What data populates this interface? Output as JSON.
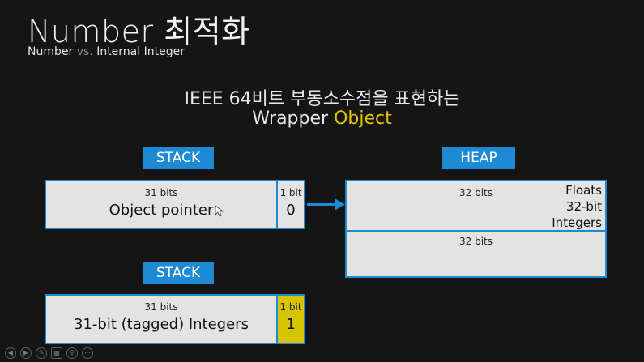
{
  "title": "Number 최적화",
  "subtitle": {
    "part1": "Number",
    "vs": "vs.",
    "part2": "Internal Integer"
  },
  "heading": {
    "line1": "IEEE 64비트 부동소수점을 표현하는",
    "line2_plain": "Wrapper",
    "line2_accent": "Object"
  },
  "stack_top": {
    "label": "STACK",
    "left_small": "31 bits",
    "left_big": "Object pointer",
    "right_small": "1 bit",
    "right_big": "0"
  },
  "heap": {
    "label": "HEAP",
    "top_small": "32 bits",
    "top_right_lines": [
      "Floats",
      "32-bit",
      "Integers"
    ],
    "bottom_small": "32 bits"
  },
  "stack_bottom": {
    "label": "STACK",
    "left_small": "31 bits",
    "left_big": "31-bit (tagged) Integers",
    "right_small": "1 bit",
    "right_big": "1"
  },
  "colors": {
    "accent_blue": "#1e8ad6",
    "accent_yellow": "#d6c400",
    "title_accent": "#e4c300",
    "background": "#151515"
  },
  "toolbar": {
    "icons": [
      "prev-icon",
      "next-icon",
      "pen-icon",
      "slides-icon",
      "zoom-icon",
      "more-icon"
    ]
  }
}
